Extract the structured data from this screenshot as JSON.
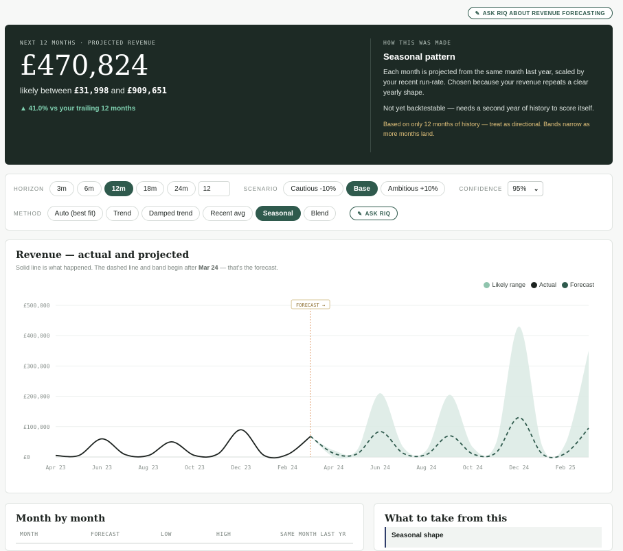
{
  "ask_top": "ASK RIQ ABOUT REVENUE FORECASTING",
  "hero": {
    "kicker": "NEXT 12 MONTHS · PROJECTED REVENUE",
    "amount": "£470,824",
    "range_prefix": "likely between",
    "range_low": "£31,998",
    "range_and": "and",
    "range_high": "£909,651",
    "delta": "▲ 41.0% vs your trailing 12 months",
    "how_kicker": "HOW THIS WAS MADE",
    "how_title": "Seasonal pattern",
    "how_p1": "Each month is projected from the same month last year, scaled by your recent run-rate. Chosen because your revenue repeats a clear yearly shape.",
    "how_p2": "Not yet backtestable — needs a second year of history to score itself.",
    "how_note": "Based on only 12 months of history — treat as directional. Bands narrow as more months land."
  },
  "controls": {
    "horizon_label": "HORIZON",
    "horizons": [
      "3m",
      "6m",
      "12m",
      "18m",
      "24m"
    ],
    "horizon_selected": 2,
    "horizon_input": "12",
    "scenario_label": "SCENARIO",
    "scenarios": [
      "Cautious -10%",
      "Base",
      "Ambitious +10%"
    ],
    "scenario_selected": 1,
    "confidence_label": "CONFIDENCE",
    "confidence_value": "95%",
    "method_label": "METHOD",
    "methods": [
      "Auto (best fit)",
      "Trend",
      "Damped trend",
      "Recent avg",
      "Seasonal",
      "Blend"
    ],
    "method_selected": 4,
    "ask_label": "ASK RIQ"
  },
  "chart": {
    "title": "Revenue — actual and projected",
    "sub_prefix": "Solid line is what happened. The dashed line and band begin after",
    "sub_month": "Mar 24",
    "sub_suffix": "— that's the forecast.",
    "legend": [
      "Likely range",
      "Actual",
      "Forecast"
    ],
    "forecast_marker": "FORECAST →"
  },
  "chart_data": {
    "type": "line",
    "x": [
      "Apr 23",
      "May 23",
      "Jun 23",
      "Jul 23",
      "Aug 23",
      "Sep 23",
      "Oct 23",
      "Nov 23",
      "Dec 23",
      "Jan 24",
      "Feb 24",
      "Mar 24",
      "Apr 24",
      "May 24",
      "Jun 24",
      "Jul 24",
      "Aug 24",
      "Sep 24",
      "Oct 24",
      "Nov 24",
      "Dec 24",
      "Jan 25",
      "Feb 25",
      "Mar 25"
    ],
    "x_ticks": [
      "Apr 23",
      "Jun 23",
      "Aug 23",
      "Oct 23",
      "Dec 23",
      "Feb 24",
      "Apr 24",
      "Jun 24",
      "Aug 24",
      "Oct 24",
      "Dec 24",
      "Feb 25"
    ],
    "y_ticks": [
      "£0",
      "£100,000",
      "£200,000",
      "£300,000",
      "£400,000",
      "£500,000"
    ],
    "ylim": [
      0,
      500000
    ],
    "series": [
      {
        "name": "Actual",
        "values": [
          5000,
          5000,
          60000,
          8000,
          5000,
          50000,
          5000,
          10000,
          90000,
          5000,
          8000,
          68000,
          null,
          null,
          null,
          null,
          null,
          null,
          null,
          null,
          null,
          null,
          null,
          null
        ],
        "color": "#1d2320"
      },
      {
        "name": "Forecast",
        "values": [
          null,
          null,
          null,
          null,
          null,
          null,
          null,
          null,
          null,
          null,
          null,
          68000,
          12000,
          10000,
          84000,
          12000,
          8000,
          70000,
          10000,
          14000,
          130000,
          10000,
          12000,
          95000
        ],
        "color": "#2f5a4d"
      }
    ],
    "band": {
      "name": "Likely range",
      "low": [
        null,
        null,
        null,
        null,
        null,
        null,
        null,
        null,
        null,
        null,
        null,
        68000,
        0,
        0,
        0,
        0,
        0,
        0,
        0,
        0,
        0,
        0,
        0,
        0
      ],
      "high": [
        null,
        null,
        null,
        null,
        null,
        null,
        null,
        null,
        null,
        null,
        null,
        68000,
        22000,
        22000,
        210000,
        32000,
        22000,
        205000,
        32000,
        45000,
        430000,
        35000,
        45000,
        350000
      ],
      "color": "#dbeae4"
    },
    "forecast_start": "Mar 24"
  },
  "month_by_month": {
    "title": "Month by month",
    "columns": [
      "MONTH",
      "FORECAST",
      "LOW",
      "HIGH",
      "SAME MONTH LAST YR"
    ]
  },
  "takeaways": {
    "title": "What to take from this",
    "first": "Seasonal shape"
  },
  "colors": {
    "accent": "#2f5a4d",
    "hero_bg": "#1d2a25",
    "band": "#dbeae4",
    "marker": "#e0a070"
  }
}
